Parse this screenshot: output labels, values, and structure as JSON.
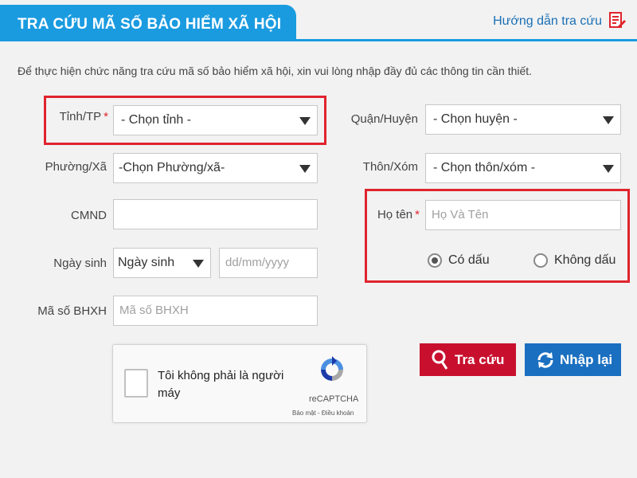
{
  "header": {
    "title": "TRA CỨU MÃ SỐ BẢO HIỂM XÃ HỘI",
    "guide_link": "Hướng dẫn tra cứu"
  },
  "intro": "Để thực hiện chức năng tra cứu mã số bảo hiểm xã hội, xin vui lòng nhập đầy đủ các thông tin cần thiết.",
  "form": {
    "province": {
      "label": "Tỉnh/TP",
      "required_mark": "*",
      "value": "- Chọn tỉnh -"
    },
    "district": {
      "label": "Quận/Huyện",
      "value": "- Chọn huyện -"
    },
    "ward": {
      "label": "Phường/Xã",
      "value": "-Chọn Phường/xã-"
    },
    "village": {
      "label": "Thôn/Xóm",
      "value": "- Chọn thôn/xóm -"
    },
    "id_card": {
      "label": "CMND",
      "value": ""
    },
    "full_name": {
      "label": "Họ tên",
      "required_mark": "*",
      "placeholder": "Họ Và Tên",
      "value": ""
    },
    "birth": {
      "label": "Ngày sinh",
      "select_value": "Ngày sinh",
      "placeholder": "dd/mm/yyyy"
    },
    "accent_options": [
      {
        "label": "Có dấu",
        "checked": true
      },
      {
        "label": "Không dấu",
        "checked": false
      }
    ],
    "bhxh": {
      "label": "Mã số BHXH",
      "placeholder": "Mã số BHXH"
    }
  },
  "recaptcha": {
    "text": "Tôi không phải là người máy",
    "brand": "reCAPTCHA",
    "links": "Bảo mật - Điều khoản"
  },
  "buttons": {
    "search": "Tra cứu",
    "reset": "Nhập lại"
  },
  "colors": {
    "header_blue": "#1a9be0",
    "highlight_red": "#e0242e",
    "search_button": "#c8102e",
    "reset_button": "#1a6fc0"
  }
}
